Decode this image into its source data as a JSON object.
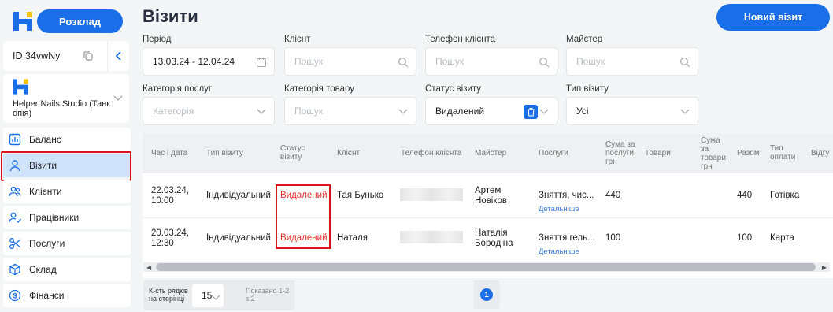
{
  "app": {
    "schedule_button": "Розклад",
    "account_id": "ID 34vwNy",
    "studio_name": "Helper Nails Studio (Танк опія)"
  },
  "nav": [
    {
      "label": "Баланс",
      "icon": "chart-icon"
    },
    {
      "label": "Візити",
      "icon": "user-icon"
    },
    {
      "label": "Клієнти",
      "icon": "users-icon"
    },
    {
      "label": "Працівники",
      "icon": "worker-icon"
    },
    {
      "label": "Послуги",
      "icon": "scissors-icon"
    },
    {
      "label": "Склад",
      "icon": "box-icon"
    },
    {
      "label": "Фінанси",
      "icon": "dollar-icon"
    }
  ],
  "header": {
    "title": "Візити",
    "new_visit_button": "Новий візит"
  },
  "filters": {
    "period": {
      "label": "Період",
      "value": "13.03.24 - 12.04.24"
    },
    "client": {
      "label": "Клієнт",
      "placeholder": "Пошук"
    },
    "client_phone": {
      "label": "Телефон клієнта",
      "placeholder": "Пошук"
    },
    "master": {
      "label": "Майстер",
      "placeholder": "Пошук"
    },
    "service_category": {
      "label": "Категорія послуг",
      "placeholder": "Категорія"
    },
    "product_category": {
      "label": "Категорія товару",
      "placeholder": "Пошук"
    },
    "visit_status": {
      "label": "Статус візиту",
      "value": "Видалений"
    },
    "visit_type": {
      "label": "Тип візиту",
      "value": "Усі"
    }
  },
  "table": {
    "columns": {
      "time_date": "Час і дата",
      "visit_type": "Тип візиту",
      "status_1": "Статус",
      "status_2": "візиту",
      "client": "Клієнт",
      "phone": "Телефон клієнта",
      "master": "Майстер",
      "services": "Послуги",
      "svc_sum_1": "Сума за",
      "svc_sum_2": "послуги,",
      "svc_sum_3": "грн",
      "products": "Товари",
      "prod_sum_1": "Сума",
      "prod_sum_2": "за",
      "prod_sum_3": "товари,",
      "prod_sum_4": "грн",
      "total": "Разом",
      "pay_type_1": "Тип",
      "pay_type_2": "оплати",
      "extra": "Відгу"
    },
    "rows": [
      {
        "date": "22.03.24,",
        "time": "10:00",
        "type": "Індивідуальний",
        "status": "Видалений",
        "client": "Тая Бунько",
        "master_1": "Артем",
        "master_2": "Новіков",
        "service": "Зняття, чис...",
        "details": "Детальніше",
        "svc_sum": "440",
        "total": "440",
        "pay": "Готівка"
      },
      {
        "date": "20.03.24,",
        "time": "12:30",
        "type": "Індивідуальний",
        "status": "Видалений",
        "client": "Наталя",
        "master_1": "Наталія",
        "master_2": "Бородіна",
        "service": "Зняття гель...",
        "details": "Детальніше",
        "svc_sum": "100",
        "total": "100",
        "pay": "Карта"
      }
    ]
  },
  "pagination": {
    "rows_label_1": "К-сть рядків",
    "rows_label_2": "на сторінці",
    "rows_value": "15",
    "shown_1": "Показано 1-2",
    "shown_2": "з 2",
    "current_page": "1"
  },
  "colors": {
    "primary": "#1a6fe8",
    "danger": "#e5322b",
    "highlight": "#d9141c"
  }
}
